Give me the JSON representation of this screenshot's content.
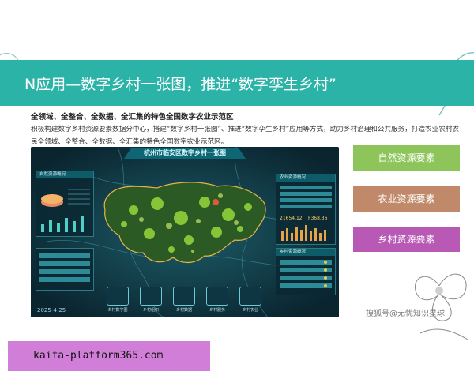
{
  "slide": {
    "title": "N应用—数字乡村一张图，推进“数字孪生乡村”",
    "subtitle": "全领域、全整合、全数据、全汇集的特色全国数字农业示范区",
    "description": "积极构建数字乡村资源要素数据分中心，搭建“数字乡村一张图”、推进“数字孪生乡村”应用等方式，助力乡村治理和公共服务，打造农业农村农民全领域、全整合、全数据、全汇集的特色全国数字农业示范区。"
  },
  "screenshot": {
    "title": "杭州市临安区数字乡村一张图",
    "date": "2025-4-25",
    "left_panel_title": "自然资源概况",
    "right_panel_title": "农业资源概况",
    "right_panel_numbers": [
      "21654.12",
      "F368.36"
    ],
    "right_panel2_title": "乡村资源概况",
    "bottom_tabs": [
      "乡村数字图",
      "乡村组织",
      "乡村数据",
      "乡村服务",
      "乡村农业"
    ]
  },
  "buttons": {
    "natural": "自然资源要素",
    "agriculture": "农业资源要素",
    "rural": "乡村资源要素"
  },
  "watermark": "搜狐号@无忧知识星球",
  "footer_url": "kaifa-platform365.com",
  "colors": {
    "band": "#2bb3a8",
    "green": "#8dc55a",
    "brown": "#c08a6a",
    "purple": "#b859b6",
    "url_bg": "#d07ed8"
  }
}
